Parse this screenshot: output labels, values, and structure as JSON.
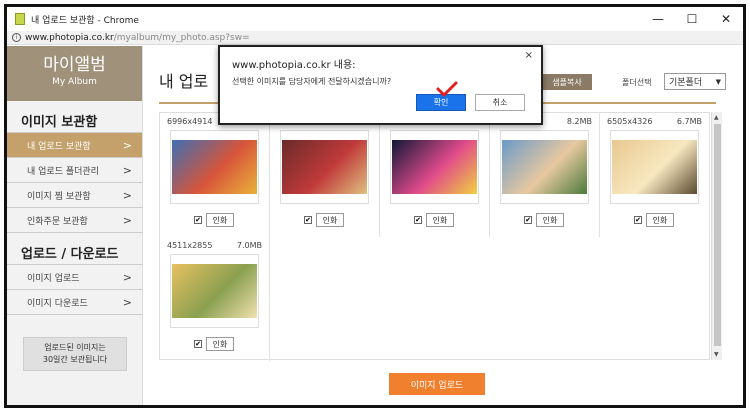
{
  "window": {
    "title": "내 업로드 보관함 - Chrome",
    "url_host": "www.photopia.co.kr",
    "url_path": "/myalbum/my_photo.asp?sw="
  },
  "sidebar": {
    "logo_title": "마이앨범",
    "logo_subtitle": "My Album",
    "section1_title": "이미지 보관함",
    "section1_items": [
      {
        "label": "내 업로드 보관함",
        "active": true
      },
      {
        "label": "내 업로드 폴더관리",
        "active": false
      },
      {
        "label": "이미지 찜 보관함",
        "active": false
      },
      {
        "label": "인화주문 보관함",
        "active": false
      }
    ],
    "section2_title": "업로드 / 다운로드",
    "section2_items": [
      {
        "label": "이미지 업로드"
      },
      {
        "label": "이미지 다운로드"
      }
    ],
    "notice": "업로드된 이미지는\n30일간 보관됩니다"
  },
  "main": {
    "page_title": "내 업로",
    "sample_copy_label": "샘플복사",
    "folder_select_label": "폴더선택",
    "folder_value": "기본폴더",
    "upload_button": "이미지 업로드"
  },
  "photos": [
    {
      "dims": "6996x4914",
      "size": "",
      "print_label": "인화",
      "checked": true,
      "palette": [
        "#3d6fb3",
        "#d8553a",
        "#e8b23a"
      ]
    },
    {
      "dims": "",
      "size": "",
      "print_label": "인화",
      "checked": true,
      "palette": [
        "#6a2a2a",
        "#c03a3a",
        "#e0c080"
      ]
    },
    {
      "dims": "",
      "size": "",
      "print_label": "인화",
      "checked": true,
      "palette": [
        "#101838",
        "#e04a8a",
        "#f0d040"
      ]
    },
    {
      "dims": "",
      "size": "8.2MB",
      "print_label": "인화",
      "checked": true,
      "palette": [
        "#6a9ac8",
        "#e8c8a0",
        "#4a7a3a"
      ]
    },
    {
      "dims": "6505x4326",
      "size": "6.7MB",
      "print_label": "인화",
      "checked": true,
      "palette": [
        "#e8c890",
        "#f8e8c0",
        "#5a4a30"
      ]
    },
    {
      "dims": "4511x2855",
      "size": "7.0MB",
      "print_label": "인화",
      "checked": true,
      "palette": [
        "#e8c060",
        "#8aa050",
        "#f0e0b0"
      ]
    }
  ],
  "dialog": {
    "host": "www.photopia.co.kr 내용:",
    "message": "선택한 이미지를 담당자에게 전달하시겠습니까?",
    "ok": "확인",
    "cancel": "취소",
    "close": "×"
  },
  "colors": {
    "accent_brown": "#c4a06a",
    "upload_orange": "#f07f2e",
    "ok_blue": "#1a73e8",
    "checkmark_red": "#e02020"
  }
}
